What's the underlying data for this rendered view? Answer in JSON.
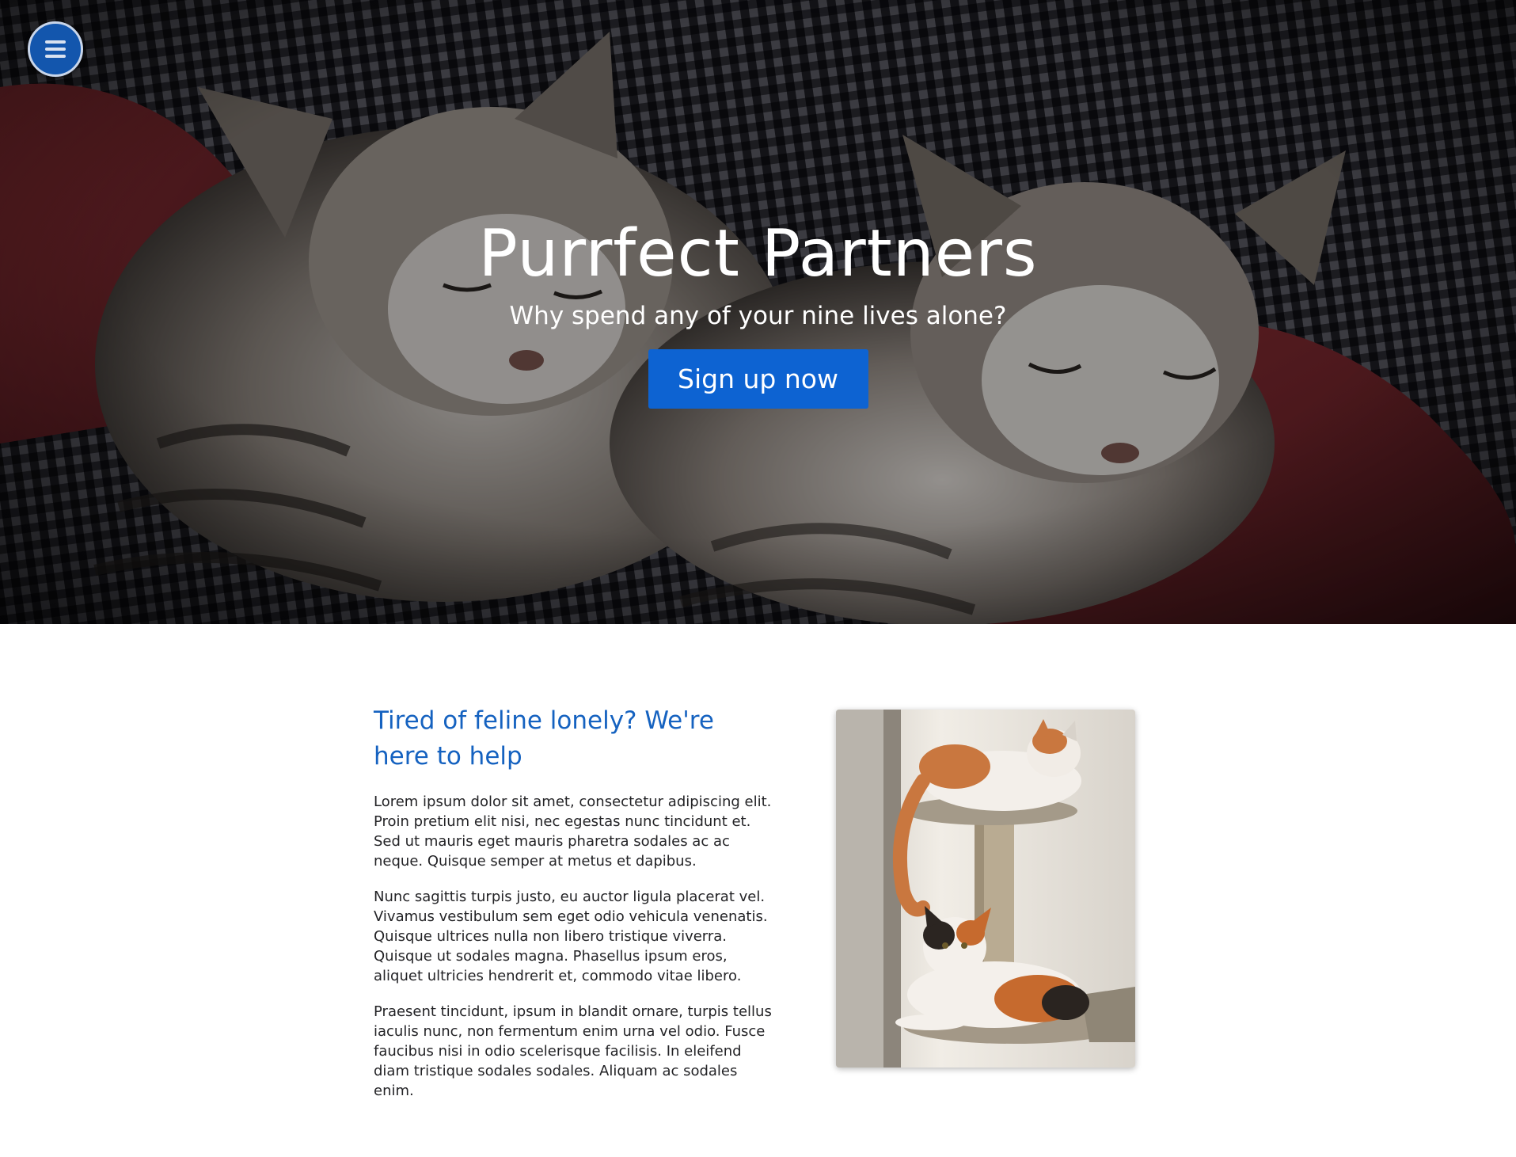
{
  "hero": {
    "title": "Purrfect Partners",
    "subtitle": "Why spend any of your nine lives alone?",
    "cta_label": "Sign up now"
  },
  "menu": {
    "icon": "hamburger-menu-icon"
  },
  "section": {
    "heading": "Tired of feline lonely? We're here to help",
    "paragraphs": [
      "Lorem ipsum dolor sit amet, consectetur adipiscing elit. Proin pretium elit nisi, nec egestas nunc tincidunt et. Sed ut mauris eget mauris pharetra sodales ac ac neque. Quisque semper at metus et dapibus.",
      "Nunc sagittis turpis justo, eu auctor ligula placerat vel. Vivamus vestibulum sem eget odio vehicula venenatis. Quisque ultrices nulla non libero tristique viverra. Quisque ut sodales magna. Phasellus ipsum eros, aliquet ultricies hendrerit et, commodo vitae libero.",
      "Praesent tincidunt, ipsum in blandit ornare, turpis tellus iaculis nunc, non fermentum enim urna vel odio. Fusce faucibus nisi in odio scelerisque facilisis. In eleifend diam tristique sodales sodales. Aliquam ac sodales enim."
    ]
  },
  "colors": {
    "accent": "#0d63d2",
    "heading": "#1562c0",
    "menu_button": "#1356ad",
    "body_text": "#232326"
  }
}
